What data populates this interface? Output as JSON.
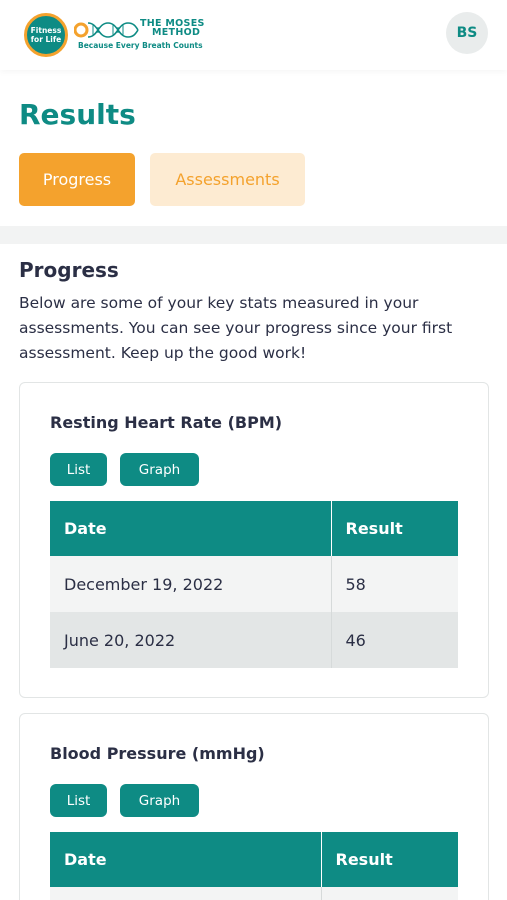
{
  "header": {
    "logo_fitness_text": "Fitness for Life",
    "logo_moses_line1": "THE MOSES",
    "logo_moses_line2": "METHOD",
    "logo_tagline": "Because Every Breath Counts",
    "avatar_initials": "BS"
  },
  "page": {
    "title": "Results",
    "tabs": [
      {
        "label": "Progress",
        "active": true
      },
      {
        "label": "Assessments",
        "active": false
      }
    ]
  },
  "progress": {
    "title": "Progress",
    "description": "Below are some of your key stats measured in your assessments. You can see your progress since your first assessment. Keep up the good work!"
  },
  "cards": [
    {
      "title": "Resting Heart Rate (BPM)",
      "list_label": "List",
      "graph_label": "Graph",
      "headers": {
        "date": "Date",
        "result": "Result"
      },
      "rows": [
        {
          "date": "December 19, 2022",
          "result": "58"
        },
        {
          "date": "June 20, 2022",
          "result": "46"
        }
      ]
    },
    {
      "title": "Blood Pressure (mmHg)",
      "list_label": "List",
      "graph_label": "Graph",
      "headers": {
        "date": "Date",
        "result": "Result"
      },
      "rows": []
    }
  ],
  "colors": {
    "brand_teal": "#0e8b84",
    "accent_orange": "#f4a22d",
    "tab_inactive_bg": "#fdebd2"
  }
}
